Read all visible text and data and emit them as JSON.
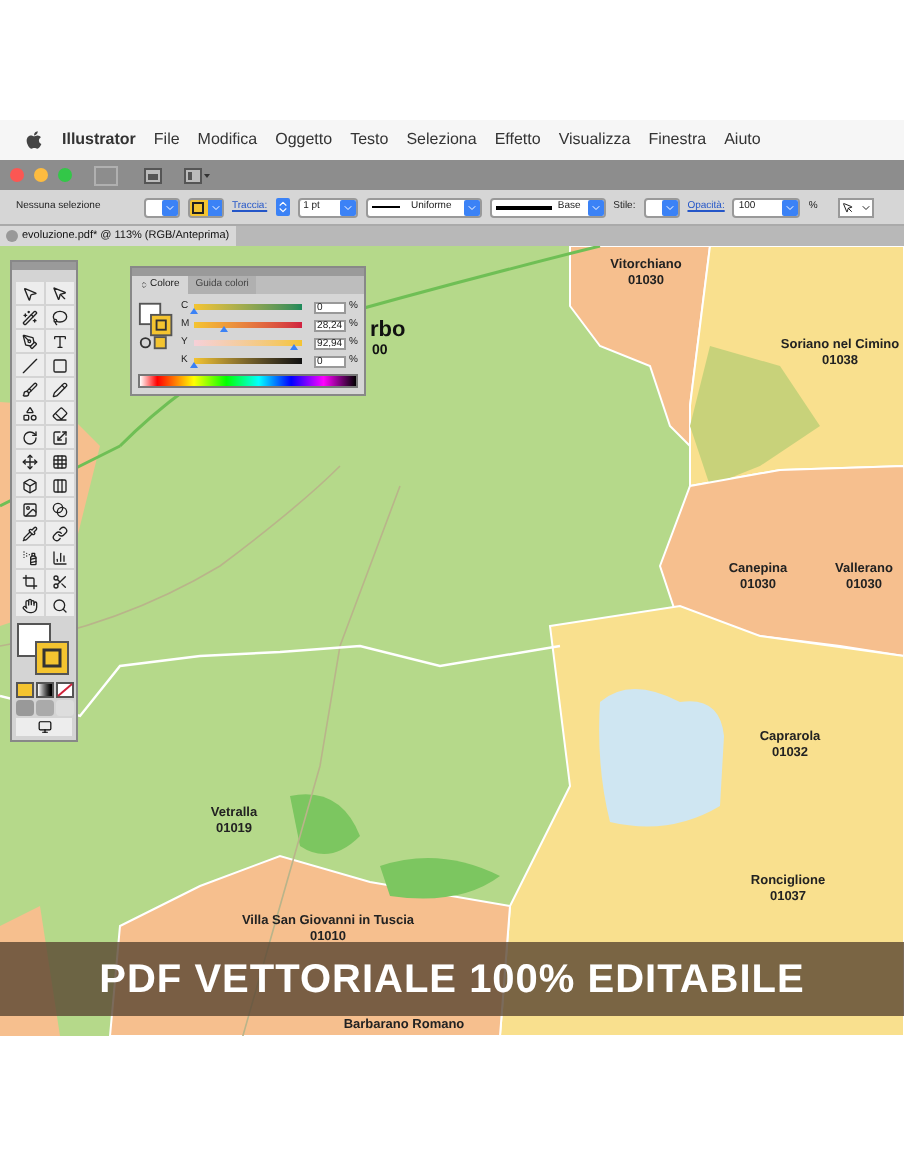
{
  "menu_bar": {
    "app_name": "Illustrator",
    "menus": [
      "File",
      "Modifica",
      "Oggetto",
      "Testo",
      "Seleziona",
      "Effetto",
      "Visualizza",
      "Finestra",
      "Aiuto"
    ]
  },
  "control_bar": {
    "selection": "Nessuna selezione",
    "stroke_label": "Traccia:",
    "stroke_weight": "1 pt",
    "profile": "Uniforme",
    "brush": "Base",
    "style_label": "Stile:",
    "opacity_label": "Opacità:",
    "opacity": "100",
    "opacity_unit": "%"
  },
  "document_tab": {
    "title": "evoluzione.pdf* @ 113% (RGB/Anteprima)"
  },
  "color_panel": {
    "tabs": [
      {
        "label": "Colore",
        "selected": true
      },
      {
        "label": "Guida colori",
        "selected": false
      }
    ],
    "sliders": [
      {
        "name": "C",
        "value": "0",
        "unit": "%",
        "level": 0
      },
      {
        "name": "M",
        "value": "28,24",
        "unit": "%",
        "level": 0.2824
      },
      {
        "name": "Y",
        "value": "92,94",
        "unit": "%",
        "level": 0.9294
      },
      {
        "name": "K",
        "value": "0",
        "unit": "%",
        "level": 0
      }
    ]
  },
  "map": {
    "partial_labels": [
      "rbo",
      "00"
    ],
    "places": [
      {
        "name": "Vitorchiano",
        "code": "01030"
      },
      {
        "name": "Soriano nel Cimino",
        "code": "01038"
      },
      {
        "name": "Canepina",
        "code": "01030"
      },
      {
        "name": "Vallerano",
        "code": "01030"
      },
      {
        "name": "Caprarola",
        "code": "01032"
      },
      {
        "name": "Vetralla",
        "code": "01019"
      },
      {
        "name": "Ronciglione",
        "code": "01037"
      },
      {
        "name": "Villa San Giovanni in Tuscia",
        "code": "01010"
      },
      {
        "name": "Barbarano Romano"
      }
    ]
  },
  "banner": {
    "text": "PDF VETTORIALE 100% EDITABILE"
  }
}
